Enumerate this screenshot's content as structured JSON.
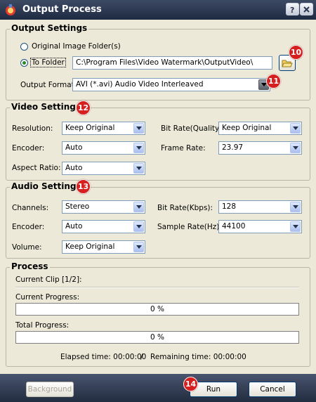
{
  "window": {
    "title": "Output Process"
  },
  "output_settings": {
    "title": "Output Settings",
    "option_original": "Original Image Folder(s)",
    "option_to_folder": "To Folder",
    "folder_path": "C:\\Program Files\\Video Watermark\\OutputVideo\\",
    "format_label": "Output Format :",
    "format_value": "AVI  (*.avi) Audio Video Interleaved",
    "badge_folder": "10",
    "badge_format": "11"
  },
  "video_settings": {
    "title": "Video Settings",
    "badge": "12",
    "resolution_label": "Resolution:",
    "resolution_value": "Keep Original",
    "encoder_label": "Encoder:",
    "encoder_value": "Auto",
    "aspect_label": "Aspect Ratio:",
    "aspect_value": "Auto",
    "bitrate_label": "Bit Rate(Quality):",
    "bitrate_value": "Keep Original",
    "framerate_label": "Frame Rate:",
    "framerate_value": "23.97"
  },
  "audio_settings": {
    "title": "Audio Settings",
    "badge": "13",
    "channels_label": "Channels:",
    "channels_value": "Stereo",
    "encoder_label": "Encoder:",
    "encoder_value": "Auto",
    "volume_label": "Volume:",
    "volume_value": "Keep Original",
    "bitrate_label": "Bit Rate(Kbps):",
    "bitrate_value": "128",
    "samplerate_label": "Sample Rate(Hz):",
    "samplerate_value": "44100"
  },
  "process": {
    "title": "Process",
    "current_clip": "Current Clip [1/2]:",
    "current_progress_label": "Current Progress:",
    "current_progress_text": "0 %",
    "current_progress_value": 0,
    "total_progress_label": "Total Progress:",
    "total_progress_text": "0 %",
    "total_progress_value": 0,
    "elapsed": "Elapsed time: 00:00:00",
    "divider": "/",
    "remaining": "Remaining time: 00:00:00"
  },
  "footer": {
    "background_label": "Background",
    "run_label": "Run",
    "cancel_label": "Cancel",
    "badge_run": "14"
  }
}
